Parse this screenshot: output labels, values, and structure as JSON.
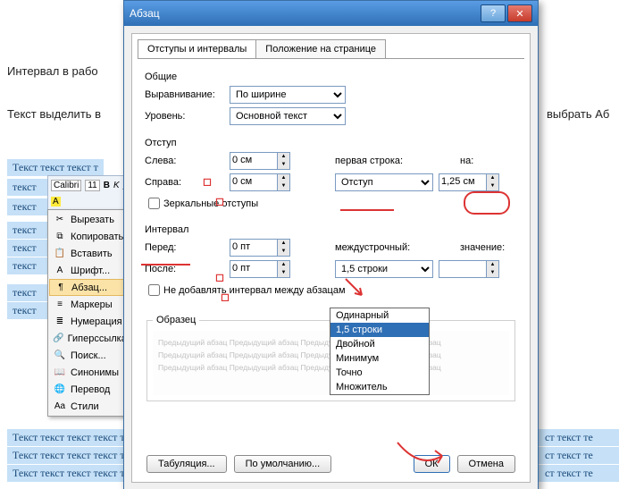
{
  "bg": {
    "line1": "Интервал в рабо",
    "line2_a": "Текст выделить в",
    "line2_b": "выбрать  Аб",
    "sample_line": "Текст текст текст т",
    "sample_cell": "текст",
    "long_line": "Текст текст текст текст текст текст текст текст текст текст текст текст текст те"
  },
  "mini_toolbar": {
    "font": "Calibri",
    "size": "11"
  },
  "context_menu": {
    "cut": "Вырезать",
    "copy": "Копировать",
    "paste": "Вставить",
    "font": "Шрифт...",
    "paragraph": "Абзац...",
    "bullets": "Маркеры",
    "numbering": "Нумерация",
    "hyperlink": "Гиперссылка...",
    "lookup": "Поиск...",
    "synonyms": "Синонимы",
    "translate": "Перевод",
    "styles": "Стили"
  },
  "dialog": {
    "title": "Абзац",
    "help_tip": "?",
    "tab1": "Отступы и интервалы",
    "tab2": "Положение на странице",
    "general": "Общие",
    "alignment_lbl": "Выравнивание:",
    "alignment_val": "По ширине",
    "level_lbl": "Уровень:",
    "level_val": "Основной текст",
    "indent": "Отступ",
    "left_lbl": "Слева:",
    "left_val": "0 см",
    "right_lbl": "Справа:",
    "right_val": "0 см",
    "mirror": "Зеркальные отступы",
    "firstline_lbl": "первая строка:",
    "firstline_val": "Отступ",
    "by_lbl": "на:",
    "by_val": "1,25 см",
    "spacing": "Интервал",
    "before_lbl": "Перед:",
    "before_val": "0 пт",
    "after_lbl": "После:",
    "after_val": "0 пт",
    "nospace": "Не добавлять интервал между абзацам",
    "linesp_lbl": "междустрочный:",
    "linesp_val": "1,5 строки",
    "value_lbl": "значение:",
    "options": {
      "single": "Одинарный",
      "one_half": "1,5 строки",
      "double": "Двойной",
      "min": "Минимум",
      "exact": "Точно",
      "mult": "Множитель"
    },
    "sample_title": "Образец",
    "sample_text": "Предыдущий абзац  Предыдущий абзац  Предыдущий абзац  Предыдущий абзац",
    "tabstops": "Табуляция...",
    "defaults": "По умолчанию...",
    "ok": "ОК",
    "cancel": "Отмена"
  },
  "chart_data": null
}
